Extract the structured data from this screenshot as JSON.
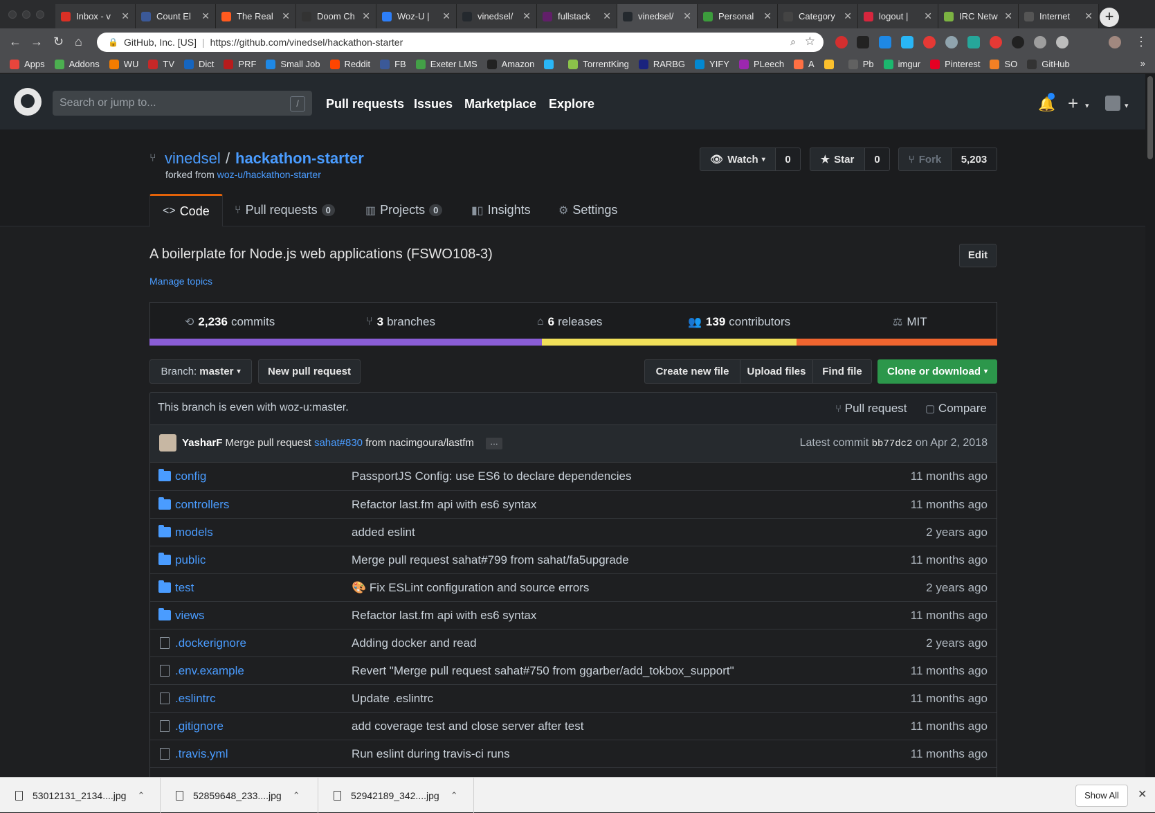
{
  "browser": {
    "tabs": [
      {
        "label": "Inbox - v",
        "color": "#d93025"
      },
      {
        "label": "Count El",
        "color": "#3b5998"
      },
      {
        "label": "The Real",
        "color": "#ff5a1f"
      },
      {
        "label": "Doom Ch",
        "color": "#333333"
      },
      {
        "label": "Woz-U |",
        "color": "#2d7ff9"
      },
      {
        "label": "vinedsel/",
        "color": "#24292e"
      },
      {
        "label": "fullstack",
        "color": "#611f69"
      },
      {
        "label": "vinedsel/",
        "color": "#24292e"
      },
      {
        "label": "Personal",
        "color": "#3c9c3c"
      },
      {
        "label": "Category",
        "color": "#444444"
      },
      {
        "label": "logout |",
        "color": "#d7263d"
      },
      {
        "label": "IRC Netw",
        "color": "#7cb342"
      },
      {
        "label": "Internet",
        "color": "#555555"
      }
    ],
    "active_tab": 7,
    "address_org": "GitHub, Inc. [US]",
    "address_url": "https://github.com/vinedsel/hackathon-starter",
    "bookmarks": [
      {
        "label": "Apps",
        "color": "#e8453c"
      },
      {
        "label": "Addons",
        "color": "#4caf50"
      },
      {
        "label": "WU",
        "color": "#f57c00"
      },
      {
        "label": "TV",
        "color": "#c62828"
      },
      {
        "label": "Dict",
        "color": "#1565c0"
      },
      {
        "label": "PRF",
        "color": "#b71c1c"
      },
      {
        "label": "Small Job",
        "color": "#1e88e5"
      },
      {
        "label": "Reddit",
        "color": "#ff4500"
      },
      {
        "label": "FB",
        "color": "#3b5998"
      },
      {
        "label": "Exeter LMS",
        "color": "#43a047"
      },
      {
        "label": "Amazon",
        "color": "#222222"
      },
      {
        "label": "",
        "color": "#29b6f6"
      },
      {
        "label": "TorrentKing",
        "color": "#8bc34a"
      },
      {
        "label": "RARBG",
        "color": "#1a237e"
      },
      {
        "label": "YIFY",
        "color": "#0288d1"
      },
      {
        "label": "PLeech",
        "color": "#9c27b0"
      },
      {
        "label": "A",
        "color": "#ff7043"
      },
      {
        "label": "",
        "color": "#fbc02d"
      },
      {
        "label": "Pb",
        "color": "#616161"
      },
      {
        "label": "imgur",
        "color": "#1bb76e"
      },
      {
        "label": "Pinterest",
        "color": "#e60023"
      },
      {
        "label": "SO",
        "color": "#f48024"
      },
      {
        "label": "GitHub",
        "color": "#333333"
      }
    ]
  },
  "github": {
    "search_placeholder": "Search or jump to...",
    "search_shortcut": "/",
    "nav": [
      "Pull requests",
      "Issues",
      "Marketplace",
      "Explore"
    ]
  },
  "repo": {
    "owner": "vinedsel",
    "name": "hackathon-starter",
    "forked_from_prefix": "forked from",
    "forked_from": "woz-u/hackathon-starter",
    "watch_label": "Watch",
    "watch_count": "0",
    "star_label": "Star",
    "star_count": "0",
    "fork_label": "Fork",
    "fork_count": "5,203",
    "tabs": [
      {
        "label": "Code",
        "icon": "code-icon"
      },
      {
        "label": "Pull requests",
        "count": "0",
        "icon": "pull-request-icon"
      },
      {
        "label": "Projects",
        "count": "0",
        "icon": "project-icon"
      },
      {
        "label": "Insights",
        "icon": "graph-icon"
      },
      {
        "label": "Settings",
        "icon": "gear-icon"
      }
    ],
    "description": "A boilerplate for Node.js web applications (FSWO108-3)",
    "edit_label": "Edit",
    "manage_topics": "Manage topics",
    "stats": {
      "commits_count": "2,236",
      "commits_label": "commits",
      "branches_count": "3",
      "branches_label": "branches",
      "releases_count": "6",
      "releases_label": "releases",
      "contributors_count": "139",
      "contributors_label": "contributors",
      "license": "MIT"
    },
    "languages": [
      {
        "share": 46.3,
        "color": "#8a5dd6"
      },
      {
        "share": 30.0,
        "color": "#f1e05a"
      },
      {
        "share": 23.7,
        "color": "#f0652f"
      }
    ],
    "branch_label": "Branch:",
    "branch_name": "master",
    "new_pr": "New pull request",
    "create_file": "Create new file",
    "upload_files": "Upload files",
    "find_file": "Find file",
    "clone": "Clone or download",
    "even_message": "This branch is even with woz-u:master.",
    "pull_request_link": "Pull request",
    "compare_link": "Compare",
    "commit": {
      "author": "YasharF",
      "message_pre": "Merge pull request",
      "pr_ref": "sahat#830",
      "message_post": "from nacimgoura/lastfm",
      "ellipsis": "…",
      "latest_label": "Latest commit",
      "sha": "bb77dc2",
      "date": "on Apr 2, 2018"
    },
    "files": [
      {
        "type": "dir",
        "name": "config",
        "message": "PassportJS Config: use ES6 to declare dependencies",
        "age": "11 months ago"
      },
      {
        "type": "dir",
        "name": "controllers",
        "message": "Refactor last.fm api with es6 syntax",
        "age": "11 months ago"
      },
      {
        "type": "dir",
        "name": "models",
        "message": "added eslint",
        "age": "2 years ago"
      },
      {
        "type": "dir",
        "name": "public",
        "message": "Merge pull request sahat#799 from sahat/fa5upgrade",
        "age": "11 months ago"
      },
      {
        "type": "dir",
        "name": "test",
        "message": "🎨 Fix ESLint configuration and source errors",
        "age": "2 years ago"
      },
      {
        "type": "dir",
        "name": "views",
        "message": "Refactor last.fm api with es6 syntax",
        "age": "11 months ago"
      },
      {
        "type": "file",
        "name": ".dockerignore",
        "message": "Adding docker and read",
        "age": "2 years ago"
      },
      {
        "type": "file",
        "name": ".env.example",
        "message": "Revert \"Merge pull request sahat#750 from ggarber/add_tokbox_support\"",
        "age": "11 months ago"
      },
      {
        "type": "file",
        "name": ".eslintrc",
        "message": "Update .eslintrc",
        "age": "11 months ago"
      },
      {
        "type": "file",
        "name": ".gitignore",
        "message": "add coverage test and close server after test",
        "age": "11 months ago"
      },
      {
        "type": "file",
        "name": ".travis.yml",
        "message": "Run eslint during travis-ci runs",
        "age": "11 months ago"
      },
      {
        "type": "file",
        "name": "",
        "message": "",
        "age": ""
      }
    ]
  },
  "downloads": {
    "items": [
      "53012131_2134....jpg",
      "52859648_233....jpg",
      "52942189_342....jpg"
    ],
    "show_all": "Show All"
  }
}
